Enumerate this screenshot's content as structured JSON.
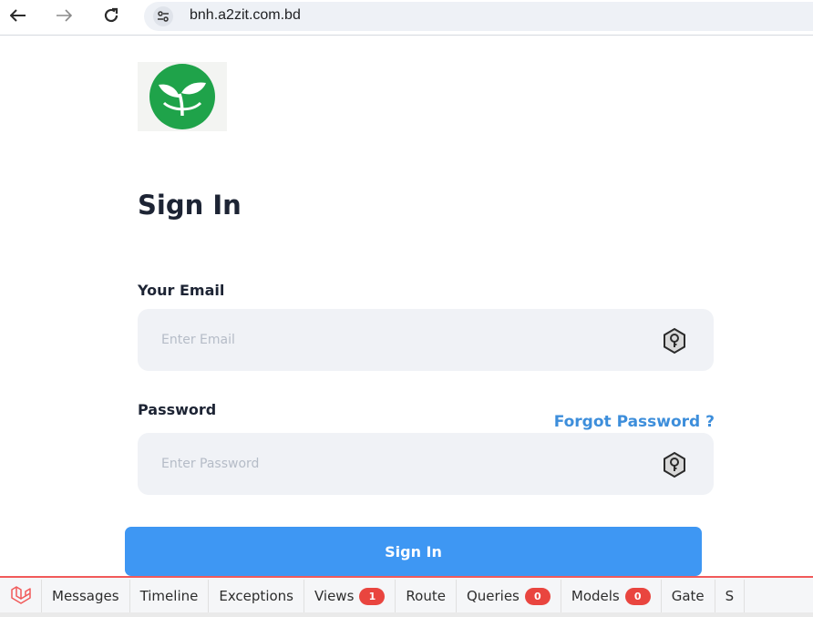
{
  "browser": {
    "back_icon": "arrow-left-icon",
    "forward_icon": "arrow-right-icon",
    "reload_icon": "reload-icon",
    "site_info_icon": "tune-icon",
    "url": "bnh.a2zit.com.bd"
  },
  "logo": {
    "icon": "sprout-leaf-icon",
    "color": "#1fa34a"
  },
  "signin": {
    "title": "Sign In",
    "email_label": "Your Email",
    "email_placeholder": "Enter Email",
    "email_value": "",
    "password_label": "Password",
    "forgot_password": "Forgot Password ?",
    "password_placeholder": "Enter Password",
    "password_value": "",
    "field_icon": "key-icon",
    "submit_label": "Sign In",
    "accent_color": "#3e97f3",
    "link_color": "#3d8edb"
  },
  "debugbar": {
    "logo_icon": "laravel-icon",
    "accent_color": "#f15a5a",
    "tabs": [
      {
        "label": "Messages"
      },
      {
        "label": "Timeline"
      },
      {
        "label": "Exceptions"
      },
      {
        "label": "Views",
        "badge": "1"
      },
      {
        "label": "Route"
      },
      {
        "label": "Queries",
        "badge": "0"
      },
      {
        "label": "Models",
        "badge": "0"
      },
      {
        "label": "Gate"
      },
      {
        "label": "S"
      }
    ]
  }
}
